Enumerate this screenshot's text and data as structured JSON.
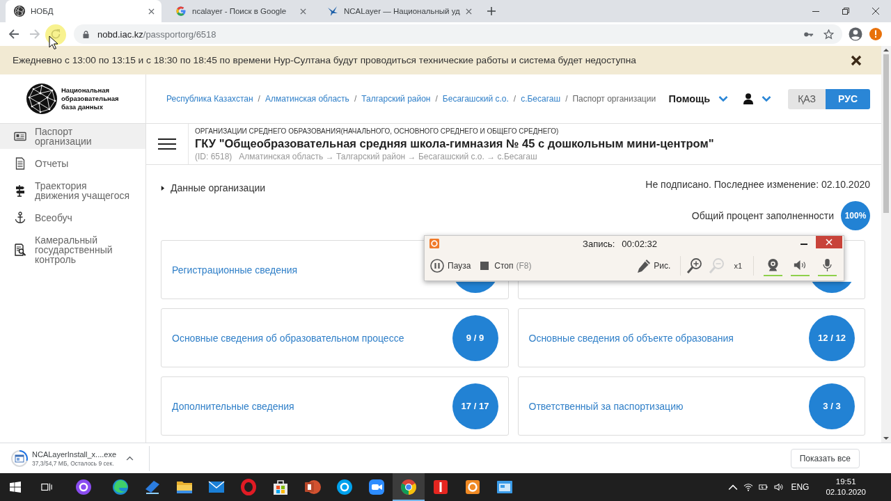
{
  "browser": {
    "tabs": [
      {
        "title": "НОБД",
        "selected": true
      },
      {
        "title": "ncalayer - Поиск в Google",
        "selected": false
      },
      {
        "title": "NCALayer — Национальный уд",
        "selected": false
      }
    ],
    "address": {
      "host": "nobd.iac.kz",
      "path": "/passportorg/6518"
    }
  },
  "notice": {
    "text": "Ежедневно с 13:00 по 13:15 и с 18:30 по 18:45 по времени Нур-Султана будут проводиться технические работы и система будет недоступна"
  },
  "header": {
    "logo": "Национальная образовательная база данных",
    "breadcrumbs": [
      {
        "kind": "link",
        "label": "Республика Казахстан"
      },
      {
        "kind": "separator",
        "label": "/"
      },
      {
        "kind": "link",
        "label": "Алматинская область"
      },
      {
        "kind": "separator",
        "label": "/"
      },
      {
        "kind": "link",
        "label": "Талгарский район"
      },
      {
        "kind": "separator",
        "label": "/"
      },
      {
        "kind": "link",
        "label": "Бесагашский с.о."
      },
      {
        "kind": "separator",
        "label": "/"
      },
      {
        "kind": "link",
        "label": "с.Бесагаш"
      },
      {
        "kind": "separator",
        "label": "/"
      },
      {
        "kind": "current",
        "label": "Паспорт организации"
      }
    ],
    "help": "Помощь",
    "languages": [
      {
        "label": "ҚАЗ",
        "selected": false
      },
      {
        "label": "РУС",
        "selected": true
      }
    ]
  },
  "sidebar": {
    "items": [
      {
        "label": "Паспорт организации",
        "selected": true
      },
      {
        "label": "Отчеты",
        "selected": false
      },
      {
        "label": "Траектория движения учащегося",
        "selected": false
      },
      {
        "label": "Всеобуч",
        "selected": false
      },
      {
        "label": "Камеральный государственный контроль",
        "selected": false
      }
    ]
  },
  "org": {
    "category": "ОРГАНИЗАЦИИ СРЕДНЕГО ОБРАЗОВАНИЯ(НАЧАЛЬНОГО, ОСНОВНОГО СРЕДНЕГО И ОБЩЕГО СРЕДНЕГО)",
    "title": "ГКУ \"Общеобразовательная средняя школа-гимназия № 45 с дошкольным мини-центром\"",
    "id": "(ID: 6518)",
    "path": "Алматинская область → Талгарский район → Бесагашский с.о. → с.Бесагаш"
  },
  "section": {
    "label": "Данные организации",
    "expanded": false
  },
  "status": "Не подписано. Последнее изменение: 02.10.2020",
  "completion": {
    "label": "Общий процент заполненности",
    "value": "100%"
  },
  "cards": [
    {
      "kind": "section",
      "title": "Регистрационные сведения"
    },
    {
      "kind": "section"
    },
    {
      "kind": "section",
      "title": "Основные сведения об образовательном процессе",
      "count": "9 / 9"
    },
    {
      "kind": "section",
      "title": "Основные сведения об объекте образования",
      "count": "12 / 12"
    },
    {
      "kind": "section",
      "title": "Дополнительные сведения",
      "count": "17 / 17"
    },
    {
      "kind": "section",
      "title": "Ответственный за паспортизацию",
      "count": "3 / 3"
    }
  ],
  "recorder": {
    "label": "Запись:",
    "time": "00:02:32",
    "pause": "Пауза",
    "stop": "Стоп",
    "stop_key": "(F8)",
    "draw": "Рис.",
    "zoom_level": "x1",
    "zoom_out_disabled": true,
    "sources": [
      {
        "on": true
      },
      {
        "on": true
      },
      {
        "on": true
      }
    ]
  },
  "download": {
    "file": "NCALayerInstall_x....exe",
    "status": "37,3/54,7 МБ, Осталось 9 сек.",
    "show_all": "Показать все"
  },
  "taskbar": {
    "apps": [
      {
        "selected": false
      },
      {
        "selected": false
      },
      {
        "selected": false
      },
      {
        "selected": false
      },
      {
        "selected": false
      },
      {
        "selected": false
      },
      {
        "selected": false
      },
      {
        "selected": false
      },
      {
        "selected": false
      },
      {
        "selected": false
      },
      {
        "selected": true
      },
      {
        "selected": false
      },
      {
        "selected": false
      },
      {
        "selected": false
      }
    ],
    "language": "ENG",
    "time": "19:51",
    "date": "02.10.2020"
  }
}
